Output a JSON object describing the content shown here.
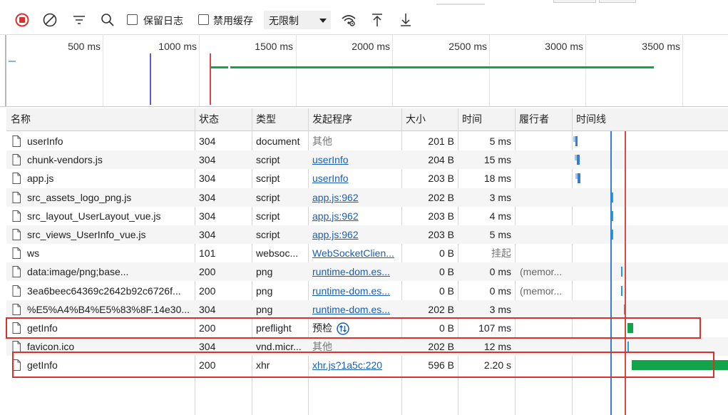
{
  "toolbar": {
    "preserve_log_label": "保留日志",
    "disable_cache_label": "禁用缓存",
    "throttling_value": "无限制"
  },
  "overview": {
    "ticks": [
      "500 ms",
      "1000 ms",
      "1500 ms",
      "2000 ms",
      "2500 ms",
      "3000 ms",
      "3500 ms"
    ]
  },
  "table": {
    "headers": {
      "name": "名称",
      "status": "状态",
      "type": "类型",
      "initiator": "发起程序",
      "size": "大小",
      "time": "时间",
      "fulfilled_by": "履行者",
      "waterfall": "时间线"
    },
    "rows": [
      {
        "name": "userInfo",
        "status": "304",
        "type": "document",
        "initiator": "其他",
        "size": "201 B",
        "time": "5 ms",
        "fulfilled_by": ""
      },
      {
        "name": "chunk-vendors.js",
        "status": "304",
        "type": "script",
        "initiator": "userInfo",
        "size": "204 B",
        "time": "15 ms",
        "fulfilled_by": ""
      },
      {
        "name": "app.js",
        "status": "304",
        "type": "script",
        "initiator": "userInfo",
        "size": "203 B",
        "time": "18 ms",
        "fulfilled_by": ""
      },
      {
        "name": "src_assets_logo_png.js",
        "status": "304",
        "type": "script",
        "initiator": "app.js:962",
        "size": "202 B",
        "time": "3 ms",
        "fulfilled_by": ""
      },
      {
        "name": "src_layout_UserLayout_vue.js",
        "status": "304",
        "type": "script",
        "initiator": "app.js:962",
        "size": "203 B",
        "time": "4 ms",
        "fulfilled_by": ""
      },
      {
        "name": "src_views_UserInfo_vue.js",
        "status": "304",
        "type": "script",
        "initiator": "app.js:962",
        "size": "203 B",
        "time": "5 ms",
        "fulfilled_by": ""
      },
      {
        "name": "ws",
        "status": "101",
        "type": "websoc...",
        "initiator": "WebSocketClien...",
        "size": "0 B",
        "time": "挂起",
        "fulfilled_by": ""
      },
      {
        "name": "data:image/png;base...",
        "status": "200",
        "type": "png",
        "initiator": "runtime-dom.es...",
        "size": "0 B",
        "time": "0 ms",
        "fulfilled_by": "(memor..."
      },
      {
        "name": "3ea6beec64369c2642b92c6726f...",
        "status": "200",
        "type": "png",
        "initiator": "runtime-dom.es...",
        "size": "0 B",
        "time": "0 ms",
        "fulfilled_by": "(memor..."
      },
      {
        "name": "%E5%A4%B4%E5%83%8F.14e30...",
        "status": "304",
        "type": "png",
        "initiator": "runtime-dom.es...",
        "size": "202 B",
        "time": "3 ms",
        "fulfilled_by": ""
      },
      {
        "name": "getInfo",
        "status": "200",
        "type": "preflight",
        "initiator": "预检",
        "size": "0 B",
        "time": "107 ms",
        "fulfilled_by": ""
      },
      {
        "name": "favicon.ico",
        "status": "304",
        "type": "vnd.micr...",
        "initiator": "其他",
        "size": "202 B",
        "time": "12 ms",
        "fulfilled_by": ""
      },
      {
        "name": "getInfo",
        "status": "200",
        "type": "xhr",
        "initiator": "xhr.js?1a5c:220",
        "size": "596 B",
        "time": "2.20 s",
        "fulfilled_by": ""
      }
    ]
  },
  "colors": {
    "record_red": "#d9312e",
    "link_blue": "#1a5fb4",
    "dom_content_loaded": "#3a7bd5",
    "load_event": "#e04646",
    "waterfall_green": "#13a34a"
  }
}
